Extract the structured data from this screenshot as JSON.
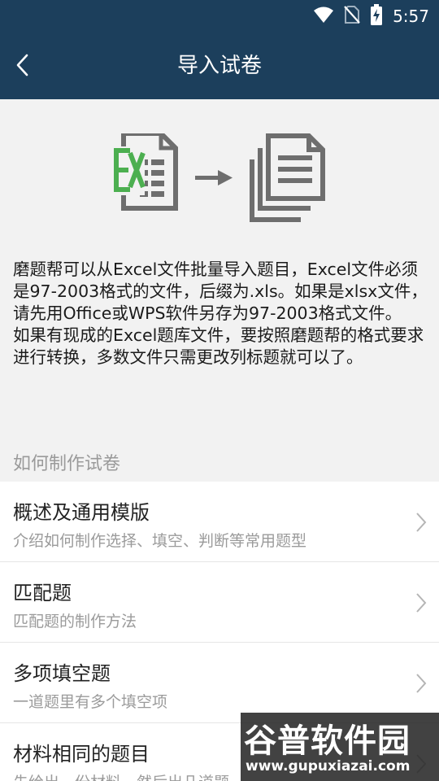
{
  "status_bar": {
    "time": "5:57"
  },
  "header": {
    "title": "导入试卷"
  },
  "description": [
    "磨题帮可以从Excel文件批量导入题目，Excel文件必须是97-2003格式的文件，后缀为.xls。如果是xlsx文件，请先用Office或WPS软件另存为97-2003格式文件。",
    "如果有现成的Excel题库文件，要按照磨题帮的格式要求进行转换，多数文件只需更改列标题就可以了。"
  ],
  "section": {
    "title": "如何制作试卷"
  },
  "items": [
    {
      "title": "概述及通用模版",
      "subtitle": "介绍如何制作选择、填空、判断等常用题型"
    },
    {
      "title": "匹配题",
      "subtitle": "匹配题的制作方法"
    },
    {
      "title": "多项填空题",
      "subtitle": "一道题里有多个填空项"
    },
    {
      "title": "材料相同的题目",
      "subtitle": "先给出一份材料，然后出几道题"
    }
  ],
  "watermark": {
    "brand": "谷普软件园",
    "url": "www.gupuxiazai.com"
  },
  "colors": {
    "header": "#1c3f5c",
    "excel_green": "#4caf50",
    "gray_icon": "#6e6e6e"
  },
  "icons": [
    "wifi-icon",
    "no-sim-icon",
    "battery-charging-icon",
    "back-arrow-icon",
    "excel-file-icon",
    "arrow-right-icon",
    "documents-icon",
    "chevron-right-icon"
  ]
}
